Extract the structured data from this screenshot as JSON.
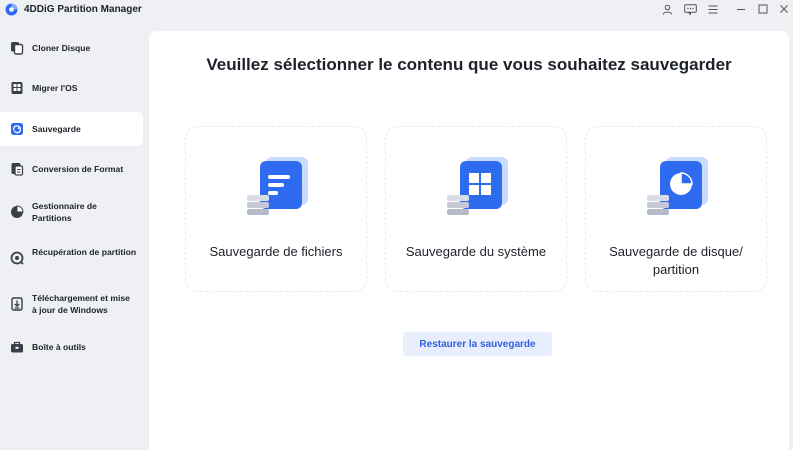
{
  "app": {
    "title": "4DDiG Partition Manager"
  },
  "window_controls": {
    "icons": [
      "user-icon",
      "feedback-icon",
      "menu-icon",
      "minimize-icon",
      "maximize-icon",
      "close-icon"
    ]
  },
  "sidebar": {
    "items": [
      {
        "label": "Cloner Disque",
        "icon": "clone-disk-icon",
        "active": false
      },
      {
        "label": "Migrer l'OS",
        "icon": "migrate-os-icon",
        "active": false
      },
      {
        "label": "Sauvegarde",
        "icon": "backup-icon",
        "active": true
      },
      {
        "label": "Conversion de Format",
        "icon": "convert-format-icon",
        "active": false
      },
      {
        "label": "Gestionnaire de Partitions",
        "icon": "partition-manager-icon",
        "active": false
      },
      {
        "label": "Récupération de partition",
        "icon": "partition-recovery-icon",
        "active": false
      },
      {
        "label": "Téléchargement et mise à jour de Windows",
        "icon": "windows-download-icon",
        "active": false
      },
      {
        "label": "Boîte à outils",
        "icon": "toolbox-icon",
        "active": false
      }
    ]
  },
  "main": {
    "title": "Veuillez sélectionner le contenu que vous souhaitez sauvegarder",
    "cards": [
      {
        "label": "Sauvegarde de fichiers",
        "icon": "file-backup-icon"
      },
      {
        "label": "Sauvegarde du système",
        "icon": "system-backup-icon"
      },
      {
        "label": "Sauvegarde de disque/ partition",
        "icon": "disk-partition-backup-icon"
      }
    ],
    "restore_label": "Restaurer la sauvegarde"
  },
  "colors": {
    "accent": "#2f6bf0",
    "background": "#eef0f4",
    "panel": "#ffffff",
    "restore_bg": "#e9eefc",
    "restore_text": "#2f5fe0"
  }
}
